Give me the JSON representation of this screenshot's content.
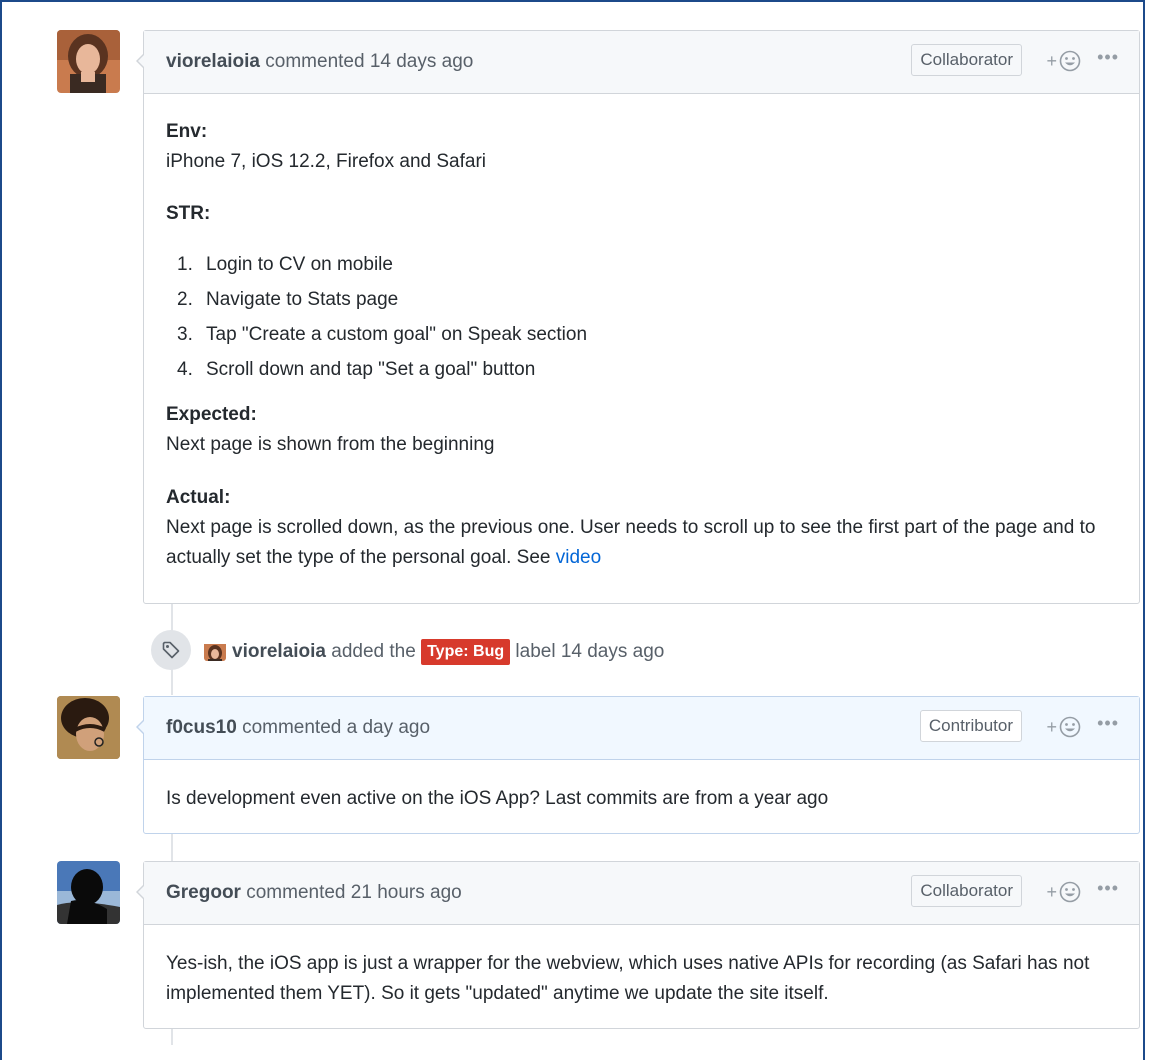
{
  "comments": [
    {
      "author": "viorelaioia",
      "meta": "commented 14 days ago",
      "role": "Collaborator",
      "body": {
        "env_heading": "Env:",
        "env_text": "iPhone 7, iOS 12.2, Firefox and Safari",
        "str_heading": "STR:",
        "steps": [
          {
            "num": "1.",
            "text": "Login to CV on mobile"
          },
          {
            "num": "2.",
            "text": "Navigate to Stats page"
          },
          {
            "num": "3.",
            "text": "Tap \"Create a custom goal\" on Speak section"
          },
          {
            "num": "4.",
            "text": "Scroll down and tap \"Set a goal\" button"
          }
        ],
        "expected_heading": "Expected:",
        "expected_text": "Next page is shown from the beginning",
        "actual_heading": "Actual:",
        "actual_text": "Next page is scrolled down, as the previous one. User needs to scroll up to see the first part of the page and to actually set the type of the personal goal. See",
        "actual_link": "video"
      }
    },
    {
      "author": "f0cus10",
      "meta": "commented a day ago",
      "role": "Contributor",
      "body_text": "Is development even active on the iOS App? Last commits are from a year ago"
    },
    {
      "author": "Gregoor",
      "meta": "commented 21 hours ago",
      "role": "Collaborator",
      "body_text": "Yes-ish, the iOS app is just a wrapper for the webview, which uses native APIs for recording (as Safari has not implemented them YET). So it gets \"updated\" anytime we update the site itself."
    }
  ],
  "event": {
    "actor": "viorelaioia",
    "action": "added the",
    "label": "Type: Bug",
    "suffix": "label 14 days ago",
    "label_color": "#d73a2c"
  },
  "reaction": {
    "plus": "+"
  },
  "more": "•••"
}
